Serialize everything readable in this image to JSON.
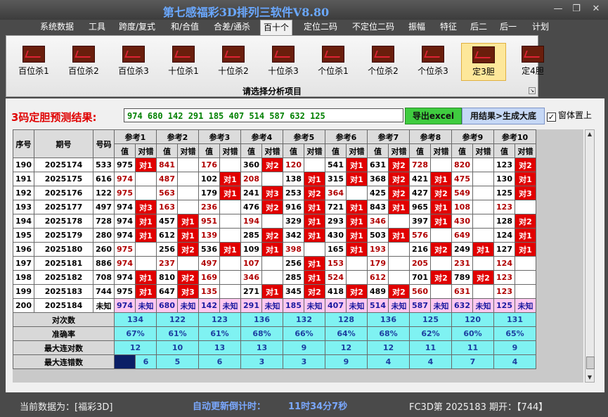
{
  "title": "第七感福彩3D排列三软件V8.80",
  "window_controls": {
    "minimize": "—",
    "restore": "❐",
    "close": "✕"
  },
  "menu": [
    "系统数据",
    "工具",
    "跨度/复式",
    "和/合值",
    "合差/通杀",
    "百十个",
    "定位二码",
    "不定位二码",
    "振幅",
    "特征",
    "后二",
    "后一",
    "计划"
  ],
  "active_menu_index": 5,
  "toolbar": {
    "buttons": [
      "百位杀1",
      "百位杀2",
      "百位杀3",
      "十位杀1",
      "十位杀2",
      "十位杀3",
      "个位杀1",
      "个位杀2",
      "个位杀3",
      "定3胆",
      "定4胆"
    ],
    "selected_index": 9,
    "caption": "请选择分析项目"
  },
  "result": {
    "label": "3码定胆预测结果:",
    "value": "974 680 142 291 185 407 514 587 632 125",
    "export_label": "导出excel",
    "generate_label": "用结果>生成大底",
    "ontop_label": "窗体置上",
    "ontop_checked": true,
    "check_mark": "✓"
  },
  "table": {
    "h_seq": "序号",
    "h_period": "期号",
    "h_number": "号码",
    "h_val": "值",
    "h_hit": "对错",
    "refs": [
      "参考1",
      "参考2",
      "参考3",
      "参考4",
      "参考5",
      "参考6",
      "参考7",
      "参考8",
      "参考9",
      "参考10"
    ],
    "rows": [
      {
        "seq": "190",
        "period": "2025174",
        "num": "533",
        "cells": [
          [
            "975",
            1,
            "对1"
          ],
          [
            "841",
            0,
            ""
          ],
          [
            "176",
            0,
            ""
          ],
          [
            "360",
            1,
            "对2"
          ],
          [
            "120",
            0,
            ""
          ],
          [
            "541",
            1,
            "对1"
          ],
          [
            "631",
            1,
            "对2"
          ],
          [
            "728",
            0,
            ""
          ],
          [
            "820",
            0,
            ""
          ],
          [
            "123",
            1,
            "对2"
          ]
        ]
      },
      {
        "seq": "191",
        "period": "2025175",
        "num": "616",
        "cells": [
          [
            "974",
            0,
            ""
          ],
          [
            "487",
            0,
            ""
          ],
          [
            "102",
            1,
            "对1"
          ],
          [
            "208",
            0,
            ""
          ],
          [
            "138",
            1,
            "对1"
          ],
          [
            "315",
            1,
            "对1"
          ],
          [
            "368",
            1,
            "对2"
          ],
          [
            "421",
            1,
            "对1"
          ],
          [
            "475",
            0,
            ""
          ],
          [
            "130",
            1,
            "对1"
          ]
        ]
      },
      {
        "seq": "192",
        "period": "2025176",
        "num": "122",
        "cells": [
          [
            "975",
            0,
            ""
          ],
          [
            "563",
            0,
            ""
          ],
          [
            "179",
            1,
            "对1"
          ],
          [
            "241",
            1,
            "对3"
          ],
          [
            "253",
            1,
            "对2"
          ],
          [
            "364",
            0,
            ""
          ],
          [
            "425",
            1,
            "对2"
          ],
          [
            "427",
            1,
            "对2"
          ],
          [
            "549",
            0,
            ""
          ],
          [
            "125",
            1,
            "对3"
          ]
        ]
      },
      {
        "seq": "193",
        "period": "2025177",
        "num": "497",
        "cells": [
          [
            "974",
            1,
            "对3"
          ],
          [
            "163",
            0,
            ""
          ],
          [
            "236",
            0,
            ""
          ],
          [
            "476",
            1,
            "对2"
          ],
          [
            "916",
            1,
            "对1"
          ],
          [
            "721",
            1,
            "对1"
          ],
          [
            "843",
            1,
            "对1"
          ],
          [
            "965",
            1,
            "对1"
          ],
          [
            "108",
            0,
            ""
          ],
          [
            "123",
            0,
            ""
          ]
        ]
      },
      {
        "seq": "194",
        "period": "2025178",
        "num": "728",
        "cells": [
          [
            "974",
            1,
            "对1"
          ],
          [
            "457",
            1,
            "对1"
          ],
          [
            "951",
            0,
            ""
          ],
          [
            "194",
            0,
            ""
          ],
          [
            "329",
            1,
            "对1"
          ],
          [
            "293",
            1,
            "对1"
          ],
          [
            "346",
            0,
            ""
          ],
          [
            "397",
            1,
            "对1"
          ],
          [
            "430",
            0,
            ""
          ],
          [
            "128",
            1,
            "对2"
          ]
        ]
      },
      {
        "seq": "195",
        "period": "2025179",
        "num": "280",
        "pcells": [
          [
            "974",
            1,
            "对1"
          ],
          [
            "612",
            1,
            "对1"
          ],
          [
            "139",
            0,
            ""
          ],
          [
            "285",
            1,
            "对2"
          ],
          [
            "342",
            1,
            "对1"
          ],
          [
            "430",
            1,
            "对1"
          ],
          [
            "503",
            1,
            "对1"
          ],
          [
            "576",
            0,
            ""
          ],
          [
            "649",
            0,
            ""
          ],
          [
            "124",
            1,
            "对1"
          ]
        ]
      },
      {
        "seq": "196",
        "period": "2025180",
        "num": "260",
        "cells": [
          [
            "975",
            0,
            ""
          ],
          [
            "256",
            1,
            "对2"
          ],
          [
            "536",
            1,
            "对1"
          ],
          [
            "109",
            1,
            "对1"
          ],
          [
            "398",
            0,
            ""
          ],
          [
            "165",
            1,
            "对1"
          ],
          [
            "193",
            0,
            ""
          ],
          [
            "216",
            1,
            "对2"
          ],
          [
            "249",
            1,
            "对1"
          ],
          [
            "127",
            1,
            "对1"
          ]
        ]
      },
      {
        "seq": "197",
        "period": "2025181",
        "num": "886",
        "cells": [
          [
            "974",
            0,
            ""
          ],
          [
            "237",
            0,
            ""
          ],
          [
            "497",
            0,
            ""
          ],
          [
            "107",
            0,
            ""
          ],
          [
            "256",
            1,
            "对1"
          ],
          [
            "153",
            0,
            ""
          ],
          [
            "179",
            0,
            ""
          ],
          [
            "205",
            0,
            ""
          ],
          [
            "231",
            0,
            ""
          ],
          [
            "124",
            0,
            ""
          ]
        ]
      },
      {
        "seq": "198",
        "period": "2025182",
        "num": "708",
        "cells": [
          [
            "974",
            1,
            "对1"
          ],
          [
            "810",
            1,
            "对2"
          ],
          [
            "169",
            0,
            ""
          ],
          [
            "346",
            0,
            ""
          ],
          [
            "285",
            1,
            "对1"
          ],
          [
            "524",
            0,
            ""
          ],
          [
            "612",
            0,
            ""
          ],
          [
            "701",
            1,
            "对2"
          ],
          [
            "789",
            1,
            "对2"
          ],
          [
            "123",
            0,
            ""
          ]
        ]
      },
      {
        "seq": "199",
        "period": "2025183",
        "num": "744",
        "cells": [
          [
            "975",
            1,
            "对1"
          ],
          [
            "647",
            1,
            "对3"
          ],
          [
            "135",
            0,
            ""
          ],
          [
            "271",
            1,
            "对1"
          ],
          [
            "345",
            1,
            "对2"
          ],
          [
            "418",
            1,
            "对2"
          ],
          [
            "489",
            1,
            "对2"
          ],
          [
            "560",
            0,
            ""
          ],
          [
            "631",
            0,
            ""
          ],
          [
            "123",
            0,
            ""
          ]
        ]
      }
    ],
    "pred_row": {
      "seq": "200",
      "period": "2025184",
      "num": "未知",
      "vals": [
        "974",
        "680",
        "142",
        "291",
        "185",
        "407",
        "514",
        "587",
        "632",
        "125"
      ],
      "status": "未知"
    },
    "stats": [
      {
        "label": "对次数",
        "vals": [
          "134",
          "122",
          "123",
          "136",
          "132",
          "128",
          "136",
          "125",
          "120",
          "131"
        ]
      },
      {
        "label": "准确率",
        "vals": [
          "67%",
          "61%",
          "61%",
          "68%",
          "66%",
          "64%",
          "68%",
          "62%",
          "60%",
          "65%"
        ]
      },
      {
        "label": "最大连对数",
        "vals": [
          "12",
          "10",
          "13",
          "13",
          "9",
          "12",
          "12",
          "11",
          "11",
          "9"
        ]
      },
      {
        "label": "最大连错数",
        "vals": [
          "6",
          "5",
          "6",
          "3",
          "3",
          "9",
          "4",
          "4",
          "7",
          "4"
        ]
      }
    ]
  },
  "status": {
    "current": "当前数据为：[福彩3D]",
    "countdown_label": "自动更新倒计时：",
    "countdown_value": "11时34分7秒",
    "draw": "FC3D第 2025183 期开：【744】"
  },
  "colors": {
    "hit_red": "#e10000",
    "stats_cyan": "#7ff2f2",
    "pred_pink": "#ffc8f0",
    "title_blue": "#6aa8ff",
    "export_green": "#3fcc3f"
  }
}
